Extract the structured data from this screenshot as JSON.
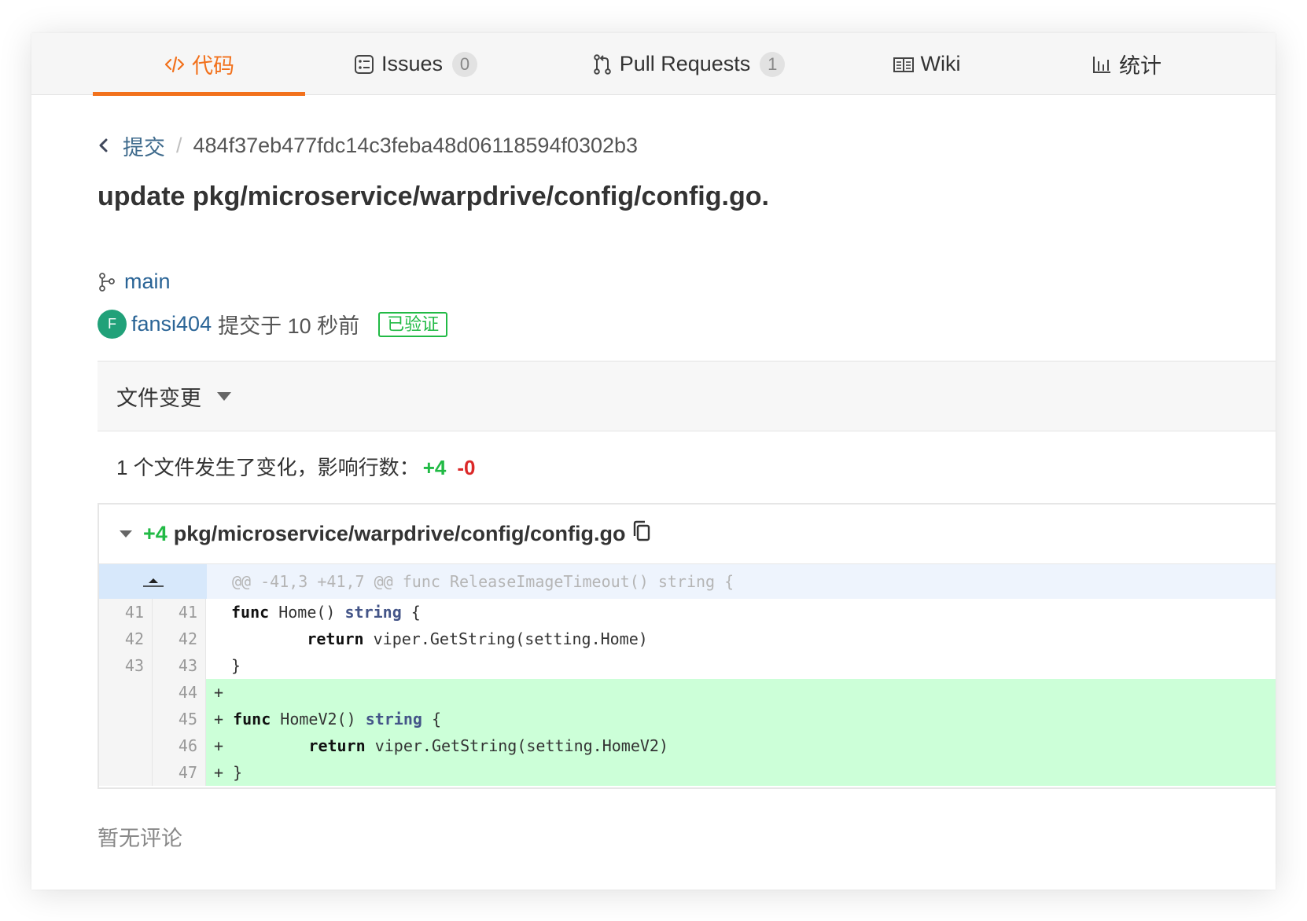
{
  "tabs": [
    {
      "label": "代码",
      "icon": "code-icon",
      "active": true
    },
    {
      "label": "Issues",
      "icon": "issues-icon",
      "count": "0"
    },
    {
      "label": "Pull Requests",
      "icon": "pull-request-icon",
      "count": "1"
    },
    {
      "label": "Wiki",
      "icon": "wiki-book-icon"
    },
    {
      "label": "统计",
      "icon": "bar-chart-icon"
    }
  ],
  "breadcrumb": {
    "back_label": "提交",
    "separator": "/",
    "commit_hash": "484f37eb477fdc14c3feba48d06118594f0302b3"
  },
  "commit": {
    "title": "update pkg/microservice/warpdrive/config/config.go.",
    "branch": "main",
    "author_initial": "F",
    "author": "fansi404",
    "time_text": "提交于 10 秒前",
    "verified_badge": "已验证"
  },
  "changes": {
    "header_label": "文件变更",
    "summary_text": "1 个文件发生了变化，影响行数：",
    "additions": "+4",
    "deletions": "-0"
  },
  "diff": {
    "additions": "+4",
    "file_path": "pkg/microservice/warpdrive/config/config.go",
    "hunk_header": "@@ -41,3 +41,7 @@ func ReleaseImageTimeout() string {",
    "lines": [
      {
        "old": "41",
        "new": "41",
        "prefix": "",
        "text": "func Home() string {"
      },
      {
        "old": "42",
        "new": "42",
        "prefix": "",
        "text": "\treturn viper.GetString(setting.Home)"
      },
      {
        "old": "43",
        "new": "43",
        "prefix": "",
        "text": "}"
      },
      {
        "old": "",
        "new": "44",
        "prefix": "+",
        "text": ""
      },
      {
        "old": "",
        "new": "45",
        "prefix": "+",
        "text": "func HomeV2() string {"
      },
      {
        "old": "",
        "new": "46",
        "prefix": "+",
        "text": "\treturn viper.GetString(setting.HomeV2)"
      },
      {
        "old": "",
        "new": "47",
        "prefix": "+",
        "text": "}"
      }
    ]
  },
  "comments": {
    "empty_text": "暂无评论"
  },
  "colors": {
    "accent_orange": "#f2711c",
    "link_blue": "#2a6496",
    "verified_green": "#21ba45",
    "deletion_red": "#db2828",
    "added_bg": "#ccffd8",
    "hunk_bg": "#d7e8fb",
    "avatar_bg": "#21a179"
  }
}
